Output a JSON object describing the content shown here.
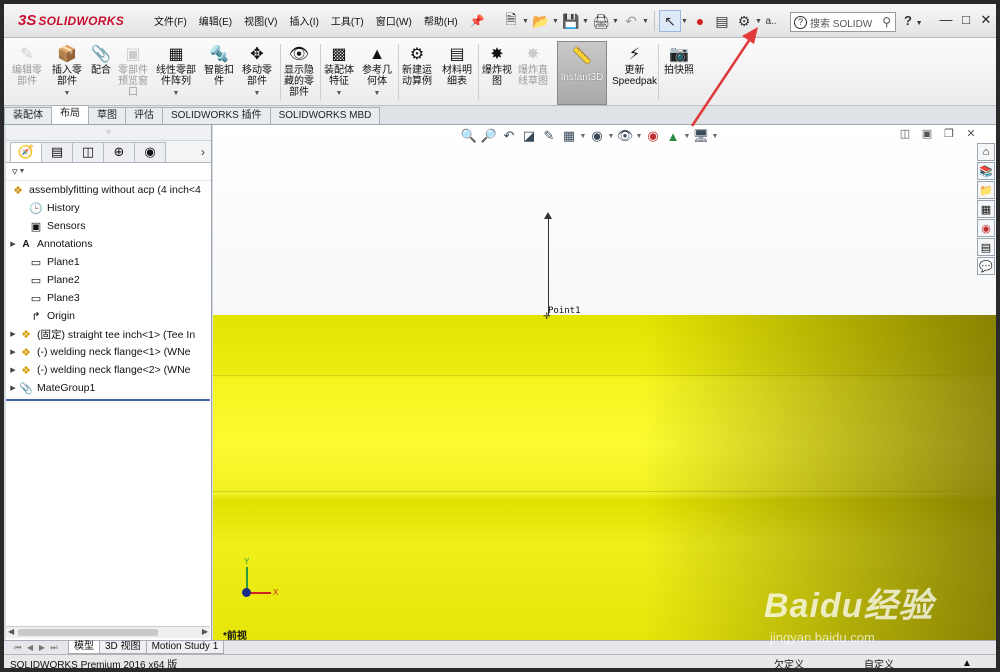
{
  "app": {
    "logo_prefix": "3S",
    "logo_text": "SOLIDWORKS"
  },
  "menu": [
    "文件(F)",
    "编辑(E)",
    "视图(V)",
    "插入(I)",
    "工具(T)",
    "窗口(W)",
    "帮助(H)"
  ],
  "quick_access": {
    "truncated_label": "a..",
    "search_placeholder": "搜索 SOLIDW",
    "help": "?"
  },
  "ribbon": [
    {
      "label": "编辑零\n部件",
      "icon": "edit-component-icon",
      "disabled": true
    },
    {
      "label": "插入零\n部件",
      "icon": "insert-component-icon",
      "disabled": false
    },
    {
      "label": "配合",
      "icon": "mate-icon",
      "disabled": false
    },
    {
      "label": "零部件\n预览窗\n口",
      "icon": "component-preview-icon",
      "disabled": true
    },
    {
      "label": "线性零部\n件阵列",
      "icon": "linear-pattern-icon",
      "disabled": false
    },
    {
      "label": "智能扣\n件",
      "icon": "smart-fasteners-icon",
      "disabled": false
    },
    {
      "label": "移动零\n部件",
      "icon": "move-component-icon",
      "disabled": false
    },
    {
      "label": "显示隐\n藏的零\n部件",
      "icon": "show-hidden-icon",
      "disabled": false
    },
    {
      "label": "装配体\n特征",
      "icon": "assembly-features-icon",
      "disabled": false
    },
    {
      "label": "参考几\n何体",
      "icon": "reference-geometry-icon",
      "disabled": false
    },
    {
      "label": "新建运\n动算例",
      "icon": "new-motion-study-icon",
      "disabled": false
    },
    {
      "label": "材料明\n细表",
      "icon": "bom-icon",
      "disabled": false
    },
    {
      "label": "爆炸视\n图",
      "icon": "exploded-view-icon",
      "disabled": false
    },
    {
      "label": "爆炸直\n线草图",
      "icon": "explode-line-sketch-icon",
      "disabled": true
    },
    {
      "label": "Instant3D",
      "icon": "instant3d-icon",
      "disabled": false
    },
    {
      "label": "更新\nSpeedpak",
      "icon": "speedpak-icon",
      "disabled": false
    },
    {
      "label": "拍快照",
      "icon": "snapshot-icon",
      "disabled": false
    }
  ],
  "tabs": [
    "装配体",
    "布局",
    "草图",
    "评估",
    "SOLIDWORKS 插件",
    "SOLIDWORKS MBD"
  ],
  "active_tab": "布局",
  "tree": {
    "root": "assemblyfitting without acp  (4 inch<4",
    "items": [
      {
        "label": "History",
        "icon": "history-icon",
        "expandable": false
      },
      {
        "label": "Sensors",
        "icon": "sensors-icon",
        "expandable": false
      },
      {
        "label": "Annotations",
        "icon": "annotations-icon",
        "expandable": true
      },
      {
        "label": "Plane1",
        "icon": "plane-icon",
        "expandable": false
      },
      {
        "label": "Plane2",
        "icon": "plane-icon",
        "expandable": false
      },
      {
        "label": "Plane3",
        "icon": "plane-icon",
        "expandable": false
      },
      {
        "label": "Origin",
        "icon": "origin-icon",
        "expandable": false
      },
      {
        "label": "(固定) straight tee inch<1> (Tee In",
        "icon": "part-icon",
        "expandable": true
      },
      {
        "label": "(-) welding neck flange<1> (WNe",
        "icon": "part-icon",
        "expandable": true
      },
      {
        "label": "(-) welding neck flange<2> (WNe",
        "icon": "part-icon",
        "expandable": true
      },
      {
        "label": "MateGroup1",
        "icon": "mates-icon",
        "expandable": true
      }
    ]
  },
  "viewport": {
    "point_label": "Point1",
    "view_name": "*前视",
    "axis_x": "X",
    "axis_y": "Y"
  },
  "bottom_tabs": [
    "模型",
    "3D 视图",
    "Motion Study 1"
  ],
  "active_bottom_tab": "模型",
  "status": {
    "app": "SOLIDWORKS Premium 2016 x64 版",
    "underdefined": "欠定义",
    "custom": "自定义",
    "caret": "▲"
  },
  "watermark": {
    "brand": "Baidu经验",
    "url": "jingyan.baidu.com"
  },
  "colors": {
    "brand_red": "#c8102e",
    "model_yellow": "#f0f020",
    "annotation_red": "#e23a3a"
  }
}
